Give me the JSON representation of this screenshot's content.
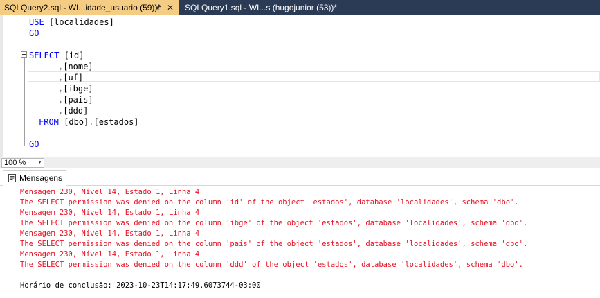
{
  "tabs": [
    {
      "title": "SQLQuery2.sql - WI...idade_usuario (59))",
      "pin_icon": "pin-icon",
      "close_icon": "close-icon"
    },
    {
      "title": "SQLQuery1.sql - WI...s (hugojunior (53))*"
    }
  ],
  "editor": {
    "lines": [
      {
        "kw": "USE",
        "rest": " [localidades]"
      },
      {
        "kw": "GO",
        "rest": ""
      },
      {
        "kw": "",
        "rest": ""
      },
      {
        "kw": "SELECT",
        "rest": " [id]"
      },
      {
        "gr": ",",
        "rest": "[nome]"
      },
      {
        "gr": ",",
        "rest": "[uf]"
      },
      {
        "gr": ",",
        "rest": "[ibge]"
      },
      {
        "gr": ",",
        "rest": "[pais]"
      },
      {
        "gr": ",",
        "rest": "[ddd]"
      },
      {
        "kw": "FROM",
        "rest": " [dbo]",
        "gr2": ".",
        "rest2": "[estados]"
      },
      {
        "kw": "",
        "rest": ""
      },
      {
        "kw": "GO",
        "rest": ""
      }
    ]
  },
  "zoom": {
    "value": "100 %"
  },
  "results": {
    "tab_label": "Mensagens",
    "messages": [
      {
        "text": "Mensagem 230, Nível 14, Estado 1, Linha 4",
        "type": "error"
      },
      {
        "text": "The SELECT permission was denied on the column 'id' of the object 'estados', database 'localidades', schema 'dbo'.",
        "type": "error"
      },
      {
        "text": "Mensagem 230, Nível 14, Estado 1, Linha 4",
        "type": "error"
      },
      {
        "text": "The SELECT permission was denied on the column 'ibge' of the object 'estados', database 'localidades', schema 'dbo'.",
        "type": "error"
      },
      {
        "text": "Mensagem 230, Nível 14, Estado 1, Linha 4",
        "type": "error"
      },
      {
        "text": "The SELECT permission was denied on the column 'pais' of the object 'estados', database 'localidades', schema 'dbo'.",
        "type": "error"
      },
      {
        "text": "Mensagem 230, Nível 14, Estado 1, Linha 4",
        "type": "error"
      },
      {
        "text": "The SELECT permission was denied on the column 'ddd' of the object 'estados', database 'localidades', schema 'dbo'.",
        "type": "error"
      },
      {
        "text": "",
        "type": "blank"
      },
      {
        "text": "Horário de conclusão: 2023-10-23T14:17:49.6073744-03:00",
        "type": "info"
      }
    ]
  },
  "colors": {
    "tab_active": "#f5cc84",
    "tab_strip": "#2b3a55",
    "keyword": "#0000ff",
    "error": "#e81123"
  }
}
